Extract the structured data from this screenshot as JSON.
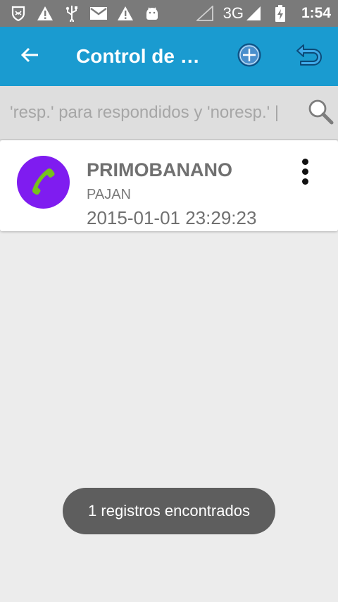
{
  "status_bar": {
    "network": "3G",
    "time": "1:54",
    "icons": [
      "shield-icon",
      "warning-icon",
      "usb-icon",
      "mail-icon",
      "warning-icon",
      "android-icon",
      "signal-icon",
      "signal-icon",
      "battery-charging-icon"
    ]
  },
  "app_bar": {
    "title": "Control de R…",
    "actions": [
      "back-arrow-icon",
      "add-circle-icon",
      "undo-icon"
    ]
  },
  "search": {
    "placeholder": "'resp.' para respondidos y 'noresp.' |"
  },
  "records": [
    {
      "name": "PRIMOBANANO",
      "place": "PAJAN",
      "datetime": "2015-01-01 23:29:23"
    }
  ],
  "toast": {
    "message": "1 registros encontrados"
  },
  "colors": {
    "status_bar": "#7a7a7a",
    "app_bar": "#1a9bd0",
    "avatar": "#7f1cf0",
    "phone_icon": "#7cc21a",
    "toast": "#5e5e5e",
    "background": "#ececec"
  }
}
